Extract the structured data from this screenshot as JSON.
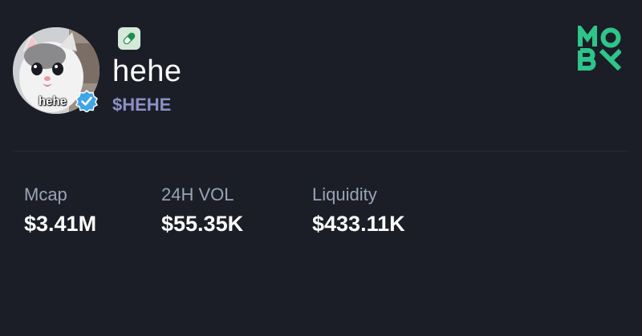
{
  "token": {
    "name": "hehe",
    "symbol": "$HEHE",
    "avatar_caption": "hehe",
    "verified_icon": "verified-check-icon",
    "platform_icon": "pill-icon"
  },
  "brand": {
    "logo_text": "MOBY",
    "color": "#2ec48a"
  },
  "stats": [
    {
      "label": "Mcap",
      "value": "$3.41M"
    },
    {
      "label": "24H VOL",
      "value": "$55.35K"
    },
    {
      "label": "Liquidity",
      "value": "$433.11K"
    }
  ],
  "colors": {
    "background": "#1b1e27",
    "symbol": "#8c90c4",
    "label": "#9ea2b8",
    "verified": "#3fa4e8"
  }
}
